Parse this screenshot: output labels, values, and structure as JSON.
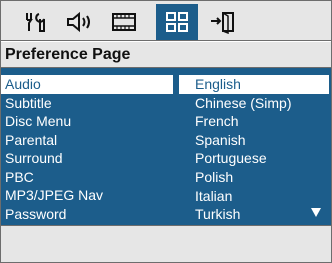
{
  "icons": [
    {
      "name": "general-setup-icon",
      "active": false
    },
    {
      "name": "audio-setup-icon",
      "active": false
    },
    {
      "name": "video-setup-icon",
      "active": false
    },
    {
      "name": "preference-setup-icon",
      "active": true
    },
    {
      "name": "exit-icon",
      "active": false
    }
  ],
  "page": {
    "title": "Preference Page"
  },
  "categories": [
    {
      "label": "Audio",
      "selected": true
    },
    {
      "label": "Subtitle",
      "selected": false
    },
    {
      "label": "Disc Menu",
      "selected": false
    },
    {
      "label": "Parental",
      "selected": false
    },
    {
      "label": "Surround",
      "selected": false
    },
    {
      "label": "PBC",
      "selected": false
    },
    {
      "label": "MP3/JPEG Nav",
      "selected": false
    },
    {
      "label": "Password",
      "selected": false
    }
  ],
  "options": [
    {
      "label": "English",
      "selected": true
    },
    {
      "label": "Chinese (Simp)",
      "selected": false
    },
    {
      "label": "French",
      "selected": false
    },
    {
      "label": "Spanish",
      "selected": false
    },
    {
      "label": "Portuguese",
      "selected": false
    },
    {
      "label": "Polish",
      "selected": false
    },
    {
      "label": "Italian",
      "selected": false
    },
    {
      "label": "Turkish",
      "selected": false
    }
  ],
  "colors": {
    "panel": "#1c5d8b",
    "bar": "#e6e6e6",
    "highlight": "#ffffff"
  }
}
